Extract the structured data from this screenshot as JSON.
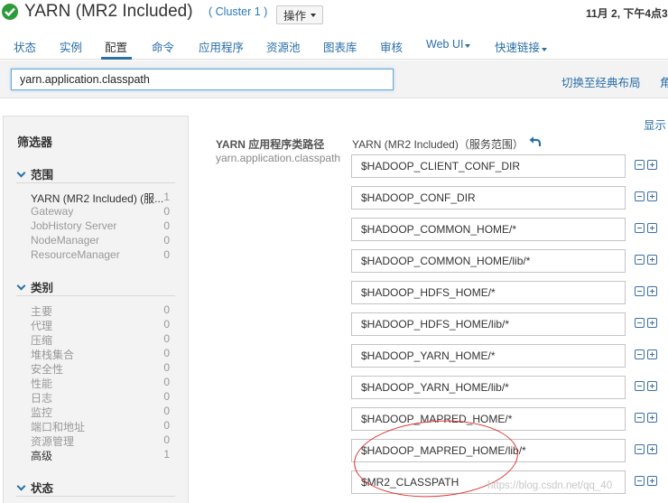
{
  "header": {
    "title": "YARN (MR2 Included)",
    "cluster": "( Cluster 1 )",
    "actions_label": "操作",
    "timestamp": "11月 2, 下午4点3"
  },
  "nav": {
    "items": [
      {
        "label": "状态",
        "active": false
      },
      {
        "label": "实例",
        "active": false
      },
      {
        "label": "配置",
        "active": true
      },
      {
        "label": "命令",
        "active": false
      },
      {
        "label": "应用程序",
        "active": false
      },
      {
        "label": "资源池",
        "active": false
      },
      {
        "label": "图表库",
        "active": false
      },
      {
        "label": "审核",
        "active": false
      },
      {
        "label": "Web UI",
        "active": false,
        "dropdown": true
      },
      {
        "label": "快速链接",
        "active": false,
        "dropdown": true
      }
    ]
  },
  "search": {
    "value": "yarn.application.classpath",
    "classic_layout": "切换至经典布局",
    "role_link": "角"
  },
  "filters": {
    "title": "筛选器",
    "scope": {
      "label": "范围",
      "items": [
        {
          "label": "YARN (MR2 Included) (服...",
          "count": "1"
        },
        {
          "label": "Gateway",
          "count": "0"
        },
        {
          "label": "JobHistory Server",
          "count": "0"
        },
        {
          "label": "NodeManager",
          "count": "0"
        },
        {
          "label": "ResourceManager",
          "count": "0"
        }
      ]
    },
    "category": {
      "label": "类别",
      "items": [
        {
          "label": "主要",
          "count": "0"
        },
        {
          "label": "代理",
          "count": "0"
        },
        {
          "label": "压缩",
          "count": "0"
        },
        {
          "label": "堆栈集合",
          "count": "0"
        },
        {
          "label": "安全性",
          "count": "0"
        },
        {
          "label": "性能",
          "count": "0"
        },
        {
          "label": "日志",
          "count": "0"
        },
        {
          "label": "监控",
          "count": "0"
        },
        {
          "label": "端口和地址",
          "count": "0"
        },
        {
          "label": "资源管理",
          "count": "0"
        },
        {
          "label": "高级",
          "count": "1"
        }
      ]
    },
    "status": {
      "label": "状态"
    }
  },
  "main": {
    "show_link": "显示",
    "property_name": "YARN 应用程序类路径",
    "property_key": "yarn.application.classpath",
    "scope_label": "YARN (MR2 Included)（服务范围）",
    "values": [
      "$HADOOP_CLIENT_CONF_DIR",
      "$HADOOP_CONF_DIR",
      "$HADOOP_COMMON_HOME/*",
      "$HADOOP_COMMON_HOME/lib/*",
      "$HADOOP_HDFS_HOME/*",
      "$HADOOP_HDFS_HOME/lib/*",
      "$HADOOP_YARN_HOME/*",
      "$HADOOP_YARN_HOME/lib/*",
      "$HADOOP_MAPRED_HOME/*",
      "$HADOOP_MAPRED_HOME/lib/*",
      "$MR2_CLASSPATH"
    ]
  },
  "watermark": "https://blog.csdn.net/qq_40",
  "colors": {
    "link": "#2a6fa8",
    "ok_green": "#2e9b3a",
    "annotation_red": "#dd3333"
  }
}
